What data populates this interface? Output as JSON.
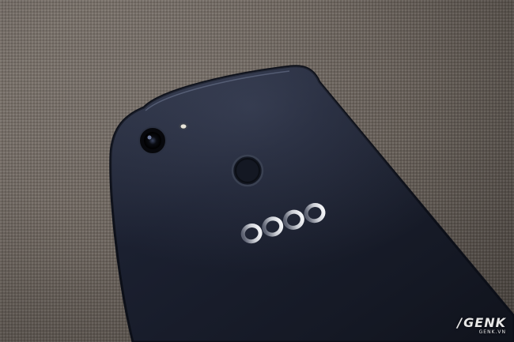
{
  "photo": {
    "subject": "smartphone-back",
    "colors": {
      "background_fabric": "#6f6760",
      "phone_body": "#1b2030",
      "phone_edge": "#0c0f18",
      "logo_silver": "#c9ccd3"
    }
  },
  "logo": {
    "text": "oppo"
  },
  "watermark": {
    "mark": "GENK",
    "sub": "GENK.VN"
  }
}
